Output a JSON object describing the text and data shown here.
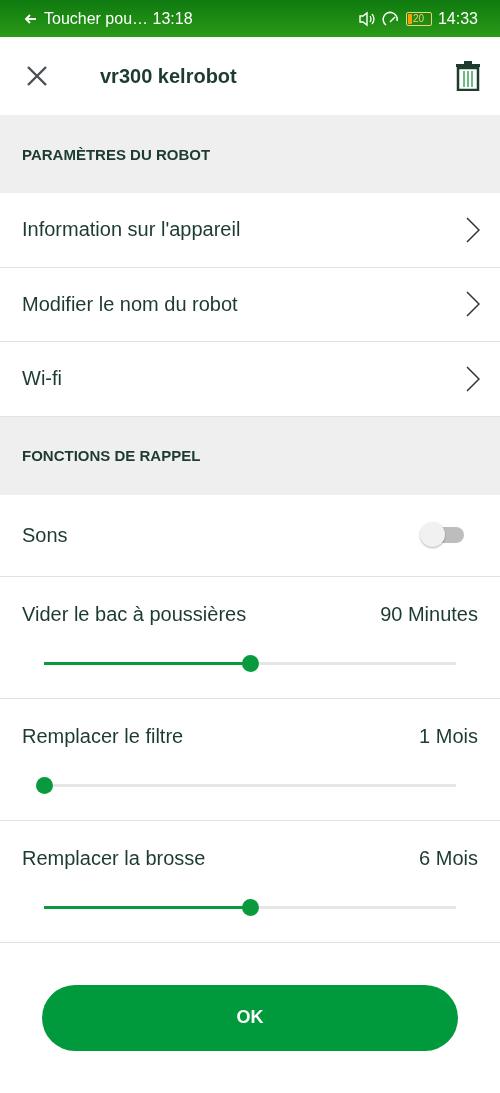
{
  "status_bar": {
    "notification": "Toucher pou… 13:18",
    "battery": "20",
    "time": "14:33"
  },
  "header": {
    "title": "vr300 kelrobot"
  },
  "sections": [
    {
      "title": "PARAMÈTRES DU ROBOT",
      "items": [
        {
          "kind": "nav",
          "label": "Information sur l'appareil"
        },
        {
          "kind": "nav",
          "label": "Modifier le nom du robot"
        },
        {
          "kind": "nav",
          "label": "Wi-fi"
        }
      ]
    },
    {
      "title": "FONCTIONS DE RAPPEL",
      "items": [
        {
          "kind": "toggle",
          "label": "Sons",
          "on": false
        },
        {
          "kind": "slider",
          "label": "Vider le bac à poussières",
          "reading": "90 Minutes",
          "level": 0.5
        },
        {
          "kind": "slider",
          "label": "Remplacer le filtre",
          "reading": "1 Mois",
          "level": 0
        },
        {
          "kind": "slider",
          "label": "Remplacer la brosse",
          "reading": "6 Mois",
          "level": 0.5
        }
      ]
    }
  ],
  "ok_button": "OK"
}
